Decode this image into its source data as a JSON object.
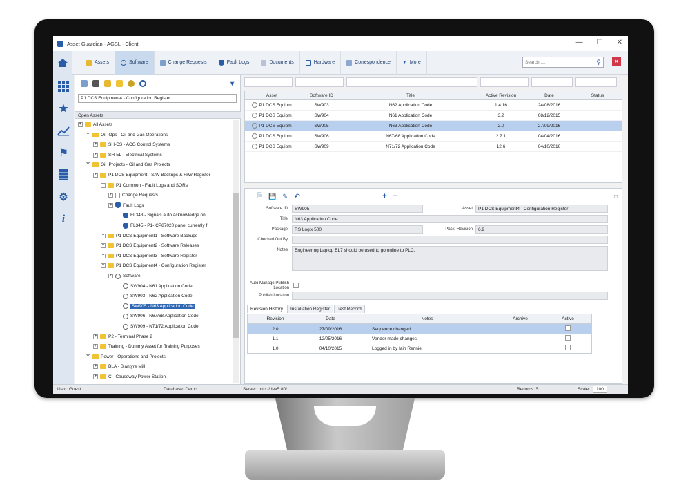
{
  "window": {
    "title": "Asset Guardian - AGSL - Client"
  },
  "toolbar": {
    "tabs": [
      {
        "label": "Assets",
        "icon": "assets-icon"
      },
      {
        "label": "Software",
        "icon": "software-icon"
      },
      {
        "label": "Change Requests",
        "icon": "change-requests-icon"
      },
      {
        "label": "Fault Logs",
        "icon": "fault-logs-icon"
      },
      {
        "label": "Documents",
        "icon": "documents-icon"
      },
      {
        "label": "Hardware",
        "icon": "hardware-icon"
      },
      {
        "label": "Correspondence",
        "icon": "correspondence-icon"
      },
      {
        "label": "More",
        "icon": "chevron-down-icon"
      }
    ],
    "search_placeholder": "Search.....",
    "active_tab": "Software"
  },
  "left_rail": [
    "home-icon",
    "grid-icon",
    "star-icon",
    "chart-icon",
    "flag-icon",
    "list-icon",
    "gear-icon",
    "info-icon"
  ],
  "tree": {
    "selector_value": "P1 DCS Equipment4 - Configuration Register",
    "open_assets_label": "Open Assets",
    "nodes": [
      {
        "label": "All Assets",
        "level": 0
      },
      {
        "label": "Oil_Ops - Oil and Gas Operations",
        "level": 1
      },
      {
        "label": "SH-CS - ACG Control Systems",
        "level": 2
      },
      {
        "label": "SH-EL - Electrical Systems",
        "level": 2
      },
      {
        "label": "Oil_Projects - Oil and Gas Projects",
        "level": 1
      },
      {
        "label": "P1 DCS Equipment - S/W Backups & H/W Register",
        "level": 2
      },
      {
        "label": "P1 Common - Fault Logs and SORs",
        "level": 3
      },
      {
        "label": "Change Requests",
        "level": 4
      },
      {
        "label": "Fault Logs",
        "level": 4
      },
      {
        "label": "FL343 - Signals auto acknowledge on",
        "level": 5
      },
      {
        "label": "FL345 - P1-ICP87020 panel currently f",
        "level": 5
      },
      {
        "label": "P1 DCS Equipment1 - Software Backups",
        "level": 3
      },
      {
        "label": "P1 DCS Equipment2 - Software Releases",
        "level": 3
      },
      {
        "label": "P1 DCS Equipment3 - Software Register",
        "level": 3
      },
      {
        "label": "P1 DCS Equipment4 - Configuration Register",
        "level": 3
      },
      {
        "label": "Software",
        "level": 4
      },
      {
        "label": "SW904 - N61 Application Code",
        "level": 5
      },
      {
        "label": "SW903 - N62 Application Code",
        "level": 5
      },
      {
        "label": "SW905 - N63 Application Code",
        "level": 5
      },
      {
        "label": "SW906 - N67/68 Application Code",
        "level": 5
      },
      {
        "label": "SW909 - N71/72 Application Code",
        "level": 5
      },
      {
        "label": "P2 - Terminal Phase 2",
        "level": 2
      },
      {
        "label": "Training - Dummy Asset for Training Purposes",
        "level": 2
      },
      {
        "label": "Power - Operations and Projects",
        "level": 1
      },
      {
        "label": "BLA - Blantyre Mill",
        "level": 2
      },
      {
        "label": "C - Causeway Power Station",
        "level": 2
      }
    ]
  },
  "grid": {
    "columns": [
      "Asset",
      "Software ID",
      "Title",
      "Active Revision",
      "Date",
      "Status"
    ],
    "rows": [
      [
        "P1 DCS Equipm",
        "SW903",
        "N62 Application Code",
        "1.4.16",
        "24/08/2016",
        ""
      ],
      [
        "P1 DCS Equipm",
        "SW904",
        "N61 Application Code",
        "3.2",
        "08/12/2015",
        ""
      ],
      [
        "P1 DCS Equipm",
        "SW905",
        "N63 Application Code",
        "2.0",
        "27/09/2016",
        ""
      ],
      [
        "P1 DCS Equipm",
        "SW906",
        "N67/68 Application Code",
        "2.7.1",
        "04/04/2016",
        ""
      ],
      [
        "P1 DCS Equipm",
        "SW909",
        "N71/72 Application Code",
        "12.6",
        "04/10/2016",
        ""
      ]
    ]
  },
  "detail": {
    "software_id_label": "Software ID",
    "software_id": "SW905",
    "asset_label": "Asset",
    "asset": "P1 DCS Equipment4 - Configuration Register",
    "title_label": "Title",
    "title": "N63 Application Code",
    "package_label": "Package",
    "package": "RS Logix 500",
    "pack_revision_label": "Pack. Revision",
    "pack_revision": "6.9",
    "checked_out_label": "Checked Out By",
    "notes_label": "Notes",
    "notes": "Engineering Laptop EL7 should be used to go online to PLC.",
    "auto_manage_label": "Auto Manage Publish Location",
    "publish_location_label": "Publish Location",
    "tabs": [
      "Revision History",
      "Installation Register",
      "Test Record"
    ],
    "rev_columns": [
      "Revision",
      "Date",
      "Notes",
      "Archive",
      "Active"
    ],
    "rev_rows": [
      [
        "2.0",
        "27/09/2016",
        "Sequence changed",
        "",
        ""
      ],
      [
        "1.1",
        "12/05/2016",
        "Vendor made changes",
        "",
        ""
      ],
      [
        "1.0",
        "04/10/2015",
        "Logged in by Iain Rennie",
        "",
        ""
      ]
    ]
  },
  "status": {
    "user": "Usrc: Guest",
    "database": "Database: Demo",
    "server": "Server: http://dev5:80/",
    "records": "Records: 5",
    "scale_label": "Scale:",
    "scale": "100"
  },
  "colors": {
    "accent": "#2a5ca8",
    "selection": "#b9cfee",
    "tree_selection": "#2f67b2"
  }
}
